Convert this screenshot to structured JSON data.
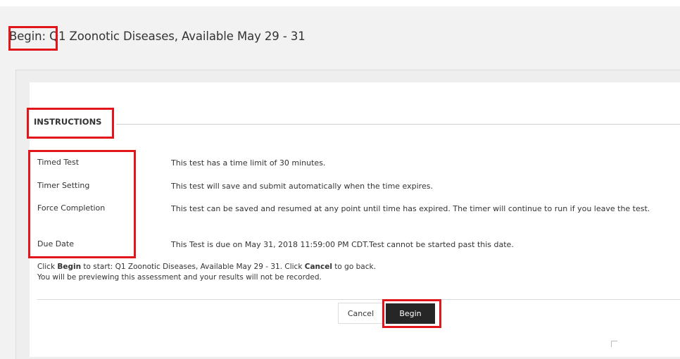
{
  "header": {
    "title_prefix": "Begin:",
    "title_rest": " Q1 Zoonotic Diseases, Available May 29 - 31"
  },
  "instructions": {
    "legend": "INSTRUCTIONS",
    "rows": [
      {
        "label": "Timed Test",
        "value": "This test has a time limit of 30 minutes."
      },
      {
        "label": "Timer Setting",
        "value": "This test will save and submit automatically when the time expires."
      },
      {
        "label": "Force Completion",
        "value": "This test can be saved and resumed at any point until time has expired. The timer will continue to run if you leave the test."
      },
      {
        "label": "Due Date",
        "value": "This Test is due on May 31, 2018 11:59:00 PM CDT.Test cannot be started past this date."
      }
    ]
  },
  "note": {
    "line1_pre": "Click ",
    "line1_begin": "Begin",
    "line1_mid": " to start: Q1 Zoonotic Diseases, Available May 29 - 31. Click ",
    "line1_cancel": "Cancel",
    "line1_post": " to go back.",
    "line2": "You will be previewing this assessment and your results will not be recorded."
  },
  "actions": {
    "cancel_label": "Cancel",
    "begin_label": "Begin"
  },
  "colors": {
    "highlight": "#e1151a",
    "begin_button": "#262626"
  }
}
